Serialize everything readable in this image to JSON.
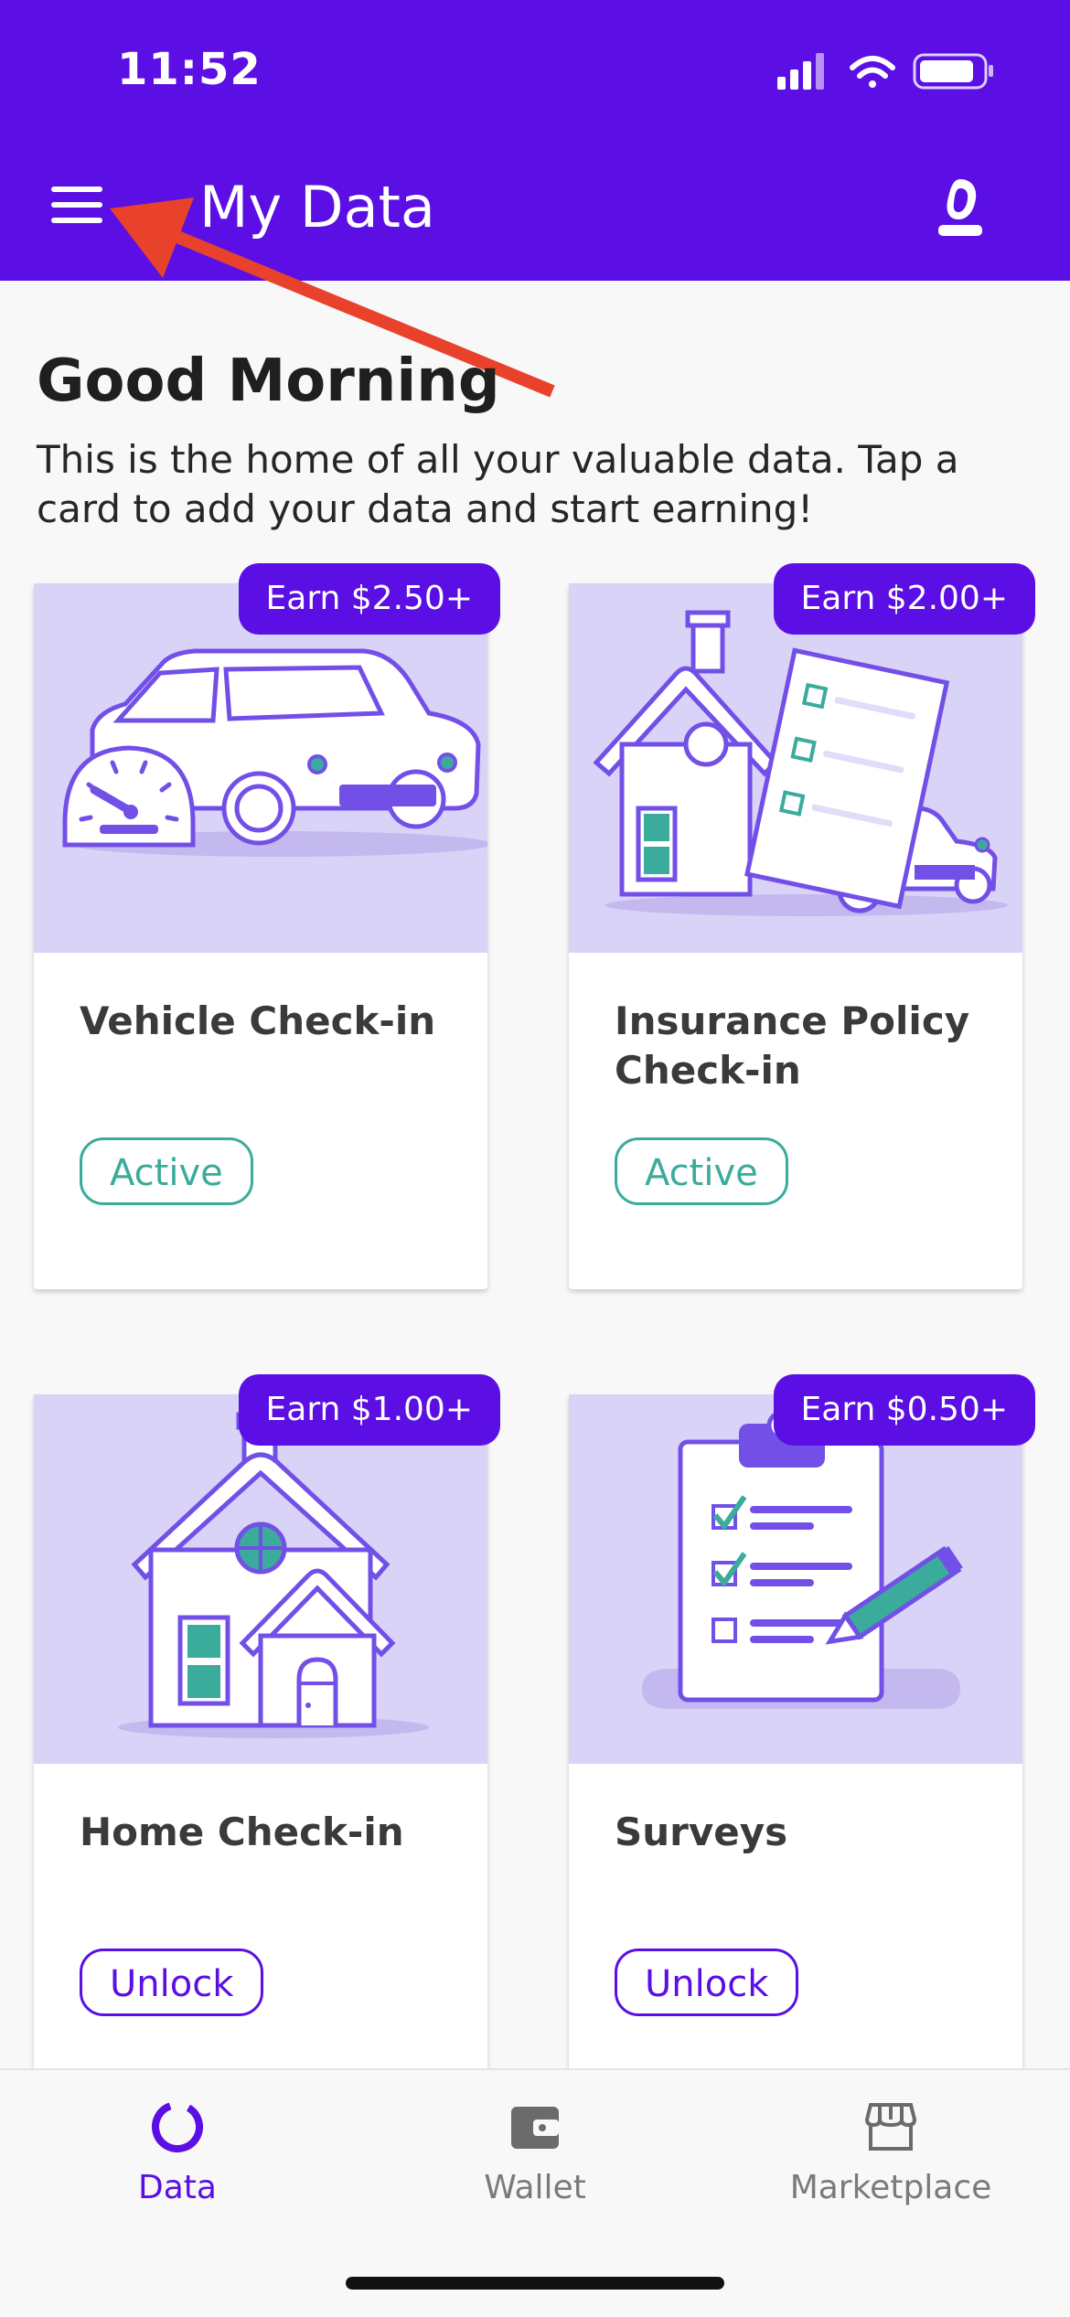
{
  "status_bar": {
    "time": "11:52"
  },
  "header": {
    "title": "My Data",
    "menu_icon": "hamburger-menu-icon",
    "profile_icon": "brand-logo-icon"
  },
  "greeting": {
    "title": "Good Morning",
    "subtitle": "This is the home of all your valuable data. Tap a card to add your data and start earning!"
  },
  "cards": [
    {
      "title": "Vehicle Check-in",
      "earn": "Earn $2.50+",
      "status": "Active",
      "illustration": "car-speedometer-illustration"
    },
    {
      "title": "Insurance Policy Check-in",
      "earn": "Earn $2.00+",
      "status": "Active",
      "illustration": "house-policy-car-illustration"
    },
    {
      "title": "Home Check-in",
      "earn": "Earn $1.00+",
      "status": "Unlock",
      "illustration": "house-illustration"
    },
    {
      "title": "Surveys",
      "earn": "Earn $0.50+",
      "status": "Unlock",
      "illustration": "clipboard-pencil-illustration"
    }
  ],
  "bottom_nav": {
    "items": [
      {
        "label": "Data",
        "icon": "data-ring-icon",
        "selected": true
      },
      {
        "label": "Wallet",
        "icon": "wallet-icon",
        "selected": false
      },
      {
        "label": "Marketplace",
        "icon": "store-icon",
        "selected": false
      }
    ]
  },
  "colors": {
    "brand": "#5b0fe4",
    "card_art_bg": "#d9d3f7",
    "active_green": "#3bab9b",
    "annotation_arrow": "#e8412c"
  }
}
